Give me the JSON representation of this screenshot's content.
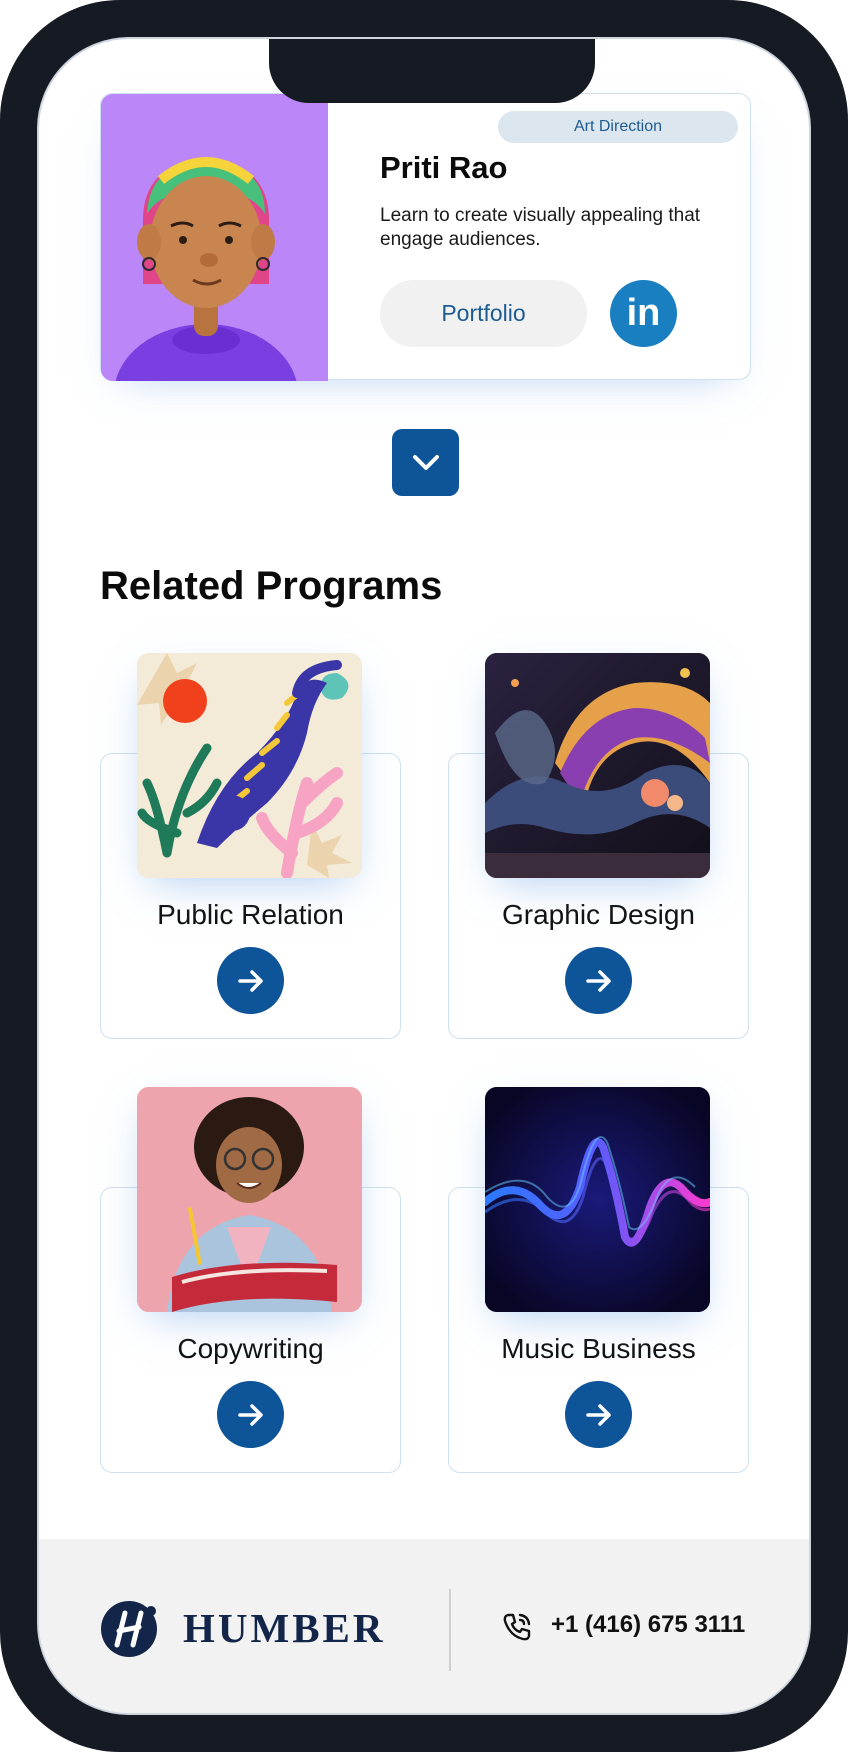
{
  "instructor": {
    "tag": "Art Direction",
    "name": "Priti Rao",
    "description": "Learn to create visually appealing that engage audiences.",
    "portfolio_label": "Portfolio",
    "social_icon": "linkedin-icon",
    "social_label": "in"
  },
  "expand_icon": "chevron-down-icon",
  "related": {
    "title": "Related Programs",
    "programs": [
      {
        "label": "Public Relation",
        "image": "tiger-illustration"
      },
      {
        "label": "Graphic Design",
        "image": "abstract-paint-splash"
      },
      {
        "label": "Copywriting",
        "image": "student-with-book"
      },
      {
        "label": "Music Business",
        "image": "sound-wave"
      }
    ]
  },
  "footer": {
    "brand": "HUMBER",
    "phone_icon": "phone-icon",
    "phone": "+1 (416) 675 3111"
  },
  "colors": {
    "primary": "#0e5498",
    "linkedin": "#1a7fc1",
    "avatar_bg": "#bb86f8",
    "brand_navy": "#13264a"
  }
}
